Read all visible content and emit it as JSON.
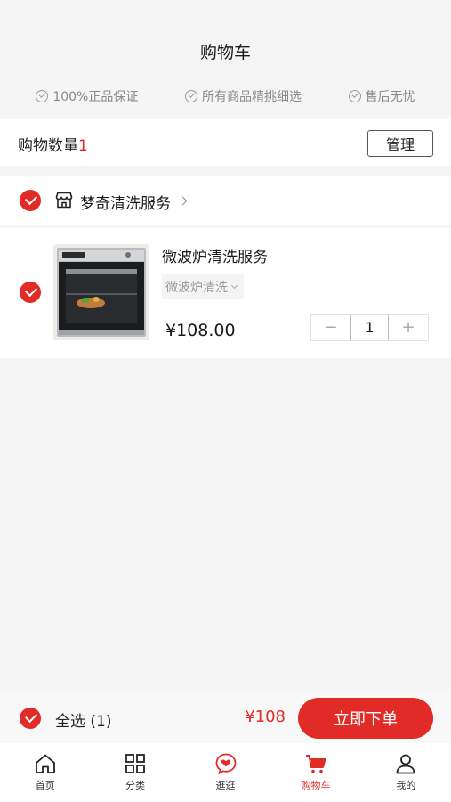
{
  "header": {
    "title": "购物车",
    "guarantees": [
      "100%正品保证",
      "所有商品精挑细选",
      "售后无忧"
    ]
  },
  "cart_count": {
    "label": "购物数量",
    "value": "1",
    "manage_label": "管理"
  },
  "shop": {
    "name": "梦奇清洗服务"
  },
  "item": {
    "title": "微波炉清洗服务",
    "variant": "微波炉清洗",
    "price": "¥108.00",
    "quantity": "1",
    "minus": "−",
    "plus": "+"
  },
  "footer": {
    "select_all": "全选 (1)",
    "total": "¥108",
    "buy_label": "立即下单"
  },
  "tabbar": {
    "items": [
      {
        "label": "首页",
        "icon": "home-icon"
      },
      {
        "label": "分类",
        "icon": "grid-icon"
      },
      {
        "label": "逛逛",
        "icon": "heart-chat-icon"
      },
      {
        "label": "购物车",
        "icon": "cart-icon"
      },
      {
        "label": "我的",
        "icon": "user-icon"
      }
    ],
    "active_index": 3
  },
  "colors": {
    "accent": "#e02b27",
    "background": "#f5f5f5"
  }
}
